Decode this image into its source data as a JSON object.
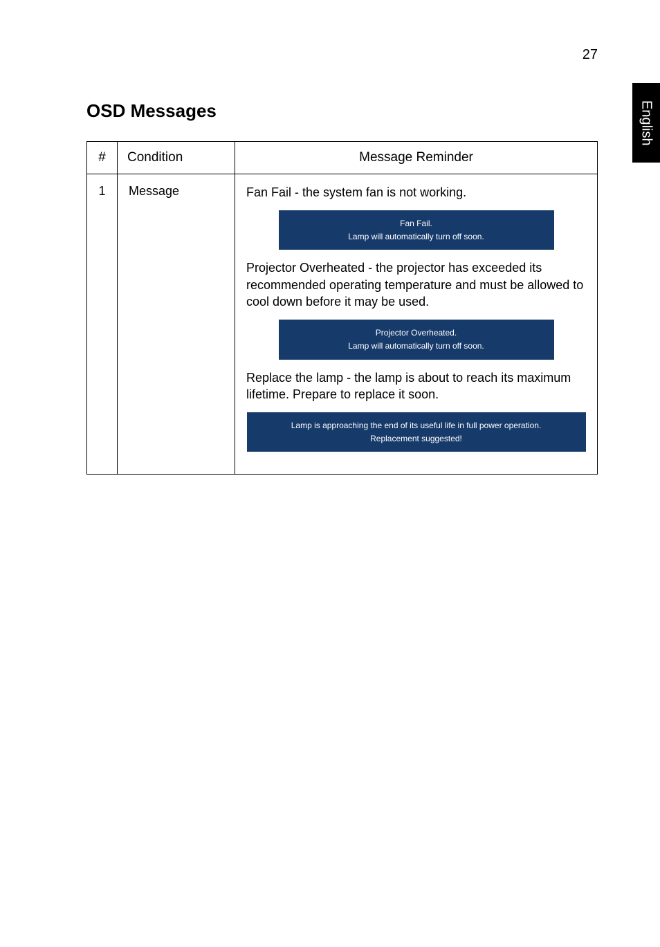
{
  "page_number": "27",
  "side_tab": "English",
  "heading": "OSD Messages",
  "table": {
    "headers": {
      "num": "#",
      "cond": "Condition",
      "msg": "Message Reminder"
    },
    "row": {
      "num": "1",
      "cond": "Message",
      "para1": "Fan Fail - the system fan is not working.",
      "box1_line1": "Fan Fail.",
      "box1_line2": "Lamp will automatically turn off soon.",
      "para2": "Projector Overheated - the projector has exceeded its recommended operating temperature and must be allowed to cool down before it may be used.",
      "box2_line1": "Projector Overheated.",
      "box2_line2": "Lamp will automatically turn off soon.",
      "para3": "Replace the lamp - the lamp is about to reach its maximum lifetime. Prepare to replace it soon.",
      "box3_line1": "Lamp is approaching the end of its useful life in full power operation.",
      "box3_line2": "Replacement suggested!"
    }
  }
}
